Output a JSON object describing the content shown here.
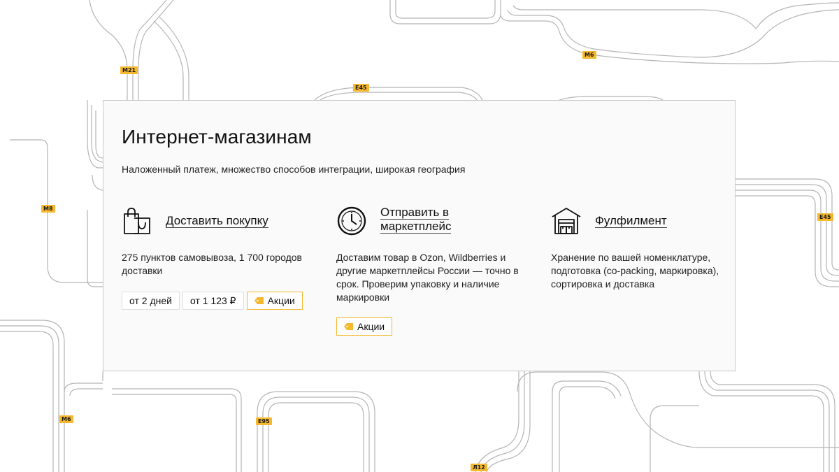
{
  "map": {
    "labels": [
      "M21",
      "E45",
      "M6",
      "M8",
      "E45",
      "M6",
      "E95",
      "Л12"
    ]
  },
  "card": {
    "title": "Интернет-магазинам",
    "subtitle": "Наложенный платеж, множество способов интеграции, широкая география"
  },
  "services": [
    {
      "icon": "shopping-bags-icon",
      "link": "Доставить покупку",
      "description": "275 пунктов самовывоза, 1 700 городов доставки",
      "tags": [
        "от 2 дней",
        "от 1 123 ₽"
      ],
      "promo": "Акции"
    },
    {
      "icon": "clock-icon",
      "link": "Отправить в маркетплейс",
      "description": "Доставим товар в Ozon, Wildberries и другие маркетплейсы России — точно в срок. Проверим упаковку и наличие маркировки",
      "promo": "Акции"
    },
    {
      "icon": "warehouse-icon",
      "link": "Фулфилмент",
      "description": "Хранение по вашей номенклатуре, подготовка (co-packing, маркировка), сортировка и доставка"
    }
  ],
  "colors": {
    "accent": "#f5b82e",
    "road": "#b5b5b5",
    "card_background": "#fafafa",
    "card_border": "#c8c8c8"
  }
}
